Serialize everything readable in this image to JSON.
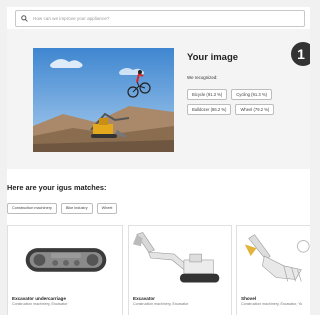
{
  "search": {
    "placeholder": "How can we improve your appliance?"
  },
  "step": {
    "number": "1"
  },
  "image_section": {
    "title": "Your image",
    "recognized_label": "We recognized:",
    "tags": [
      "Bicycle (91.3 %)",
      "Cycling (91.3 %)",
      "Bulldozer (86.2 %)",
      "Wheel (79.2 %)"
    ]
  },
  "matches": {
    "title": "Here are your igus matches:",
    "filters": [
      "Construction machinery",
      "Bike industry",
      "Wheel"
    ],
    "cards": [
      {
        "title": "Excavator undercarriage",
        "subtitle": "Construction machinery, Excavator"
      },
      {
        "title": "Excavator",
        "subtitle": "Construction machinery, Excavator"
      },
      {
        "title": "Shovel",
        "subtitle": "Construction machinery, Excavator, Yo"
      }
    ]
  },
  "colors": {
    "page_bg": "#f4f4f4",
    "badge": "#333333",
    "sky": "#5b9ad6",
    "dirt": "#9a7d5b"
  }
}
